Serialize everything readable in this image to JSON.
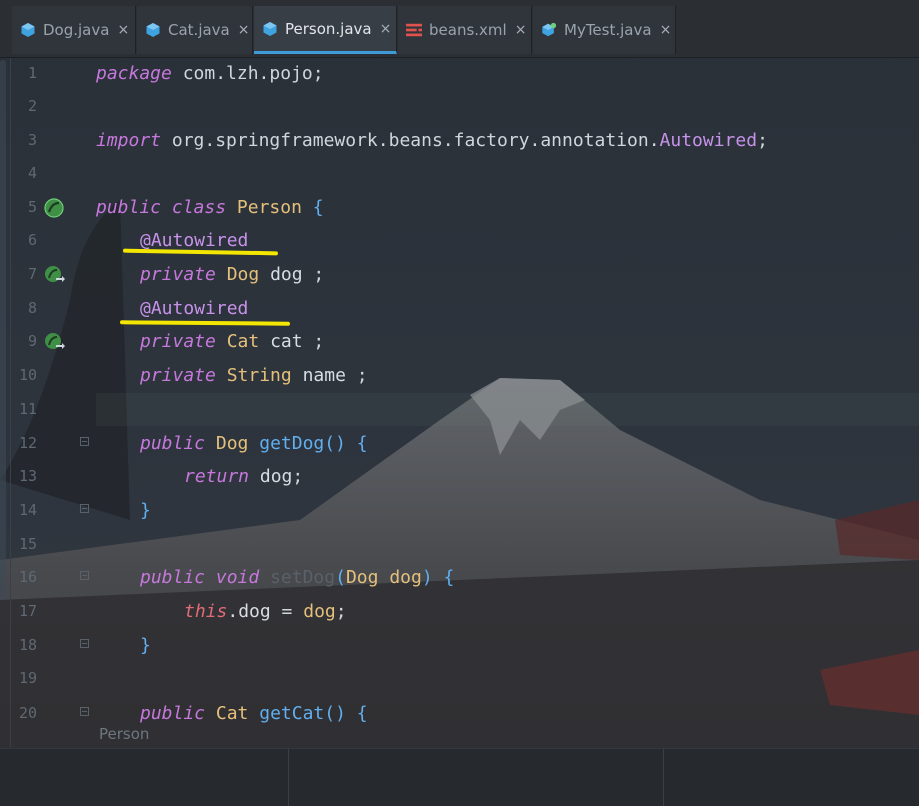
{
  "tabs": [
    {
      "label": "Dog.java",
      "icon": "java-class-icon",
      "active": false
    },
    {
      "label": "Cat.java",
      "icon": "java-class-icon",
      "active": false
    },
    {
      "label": "Person.java",
      "icon": "java-class-icon",
      "active": true
    },
    {
      "label": "beans.xml",
      "icon": "xml-file-icon",
      "active": false
    },
    {
      "label": "MyTest.java",
      "icon": "java-test-class-icon",
      "active": false
    }
  ],
  "close_glyph": "×",
  "line_numbers": [
    "1",
    "2",
    "3",
    "4",
    "5",
    "6",
    "7",
    "8",
    "9",
    "10",
    "11",
    "12",
    "13",
    "14",
    "15",
    "16",
    "17",
    "18",
    "19",
    "20"
  ],
  "code": {
    "l1": {
      "kw": "package",
      "rest": " com.lzh.pojo;"
    },
    "l3": {
      "kw": "import",
      "pkg": " org.springframework.beans.factory.annotation.",
      "cls": "Autowired",
      "end": ";"
    },
    "l5": {
      "kw1": "public",
      "kw2": "class",
      "name": "Person",
      "brace": "{"
    },
    "l6": {
      "ann": "@Autowired"
    },
    "l7": {
      "kw": "private",
      "type": "Dog",
      "name": "dog",
      "end": ";"
    },
    "l8": {
      "ann": "@Autowired"
    },
    "l9": {
      "kw": "private",
      "type": "Cat",
      "name": "cat",
      "end": ";"
    },
    "l10": {
      "kw": "private",
      "type": "String",
      "name": "name",
      "end": ";"
    },
    "l12": {
      "kw": "public",
      "type": "Dog",
      "fn": "getDog",
      "paren": "()",
      "brace": "{"
    },
    "l13": {
      "kw": "return",
      "name": "dog",
      "end": ";"
    },
    "l14": {
      "brace": "}"
    },
    "l16": {
      "kw1": "public",
      "kw2": "void",
      "fn": "setDog",
      "po": "(",
      "type": "Dog",
      "param": "dog",
      "pc": ")",
      "brace": "{"
    },
    "l17": {
      "this": "this",
      "field": ".dog",
      "op": " = ",
      "val": "dog",
      "end": ";"
    },
    "l18": {
      "brace": "}"
    },
    "l20": {
      "kw": "public",
      "type": "Cat",
      "fn": "getCat",
      "paren": "()",
      "brace": "{"
    }
  },
  "breadcrumb": "Person",
  "colors": {
    "underline": "#f3e600",
    "active_tab_accent": "#3d9ad6",
    "gutter_icon": "#4caf50"
  }
}
